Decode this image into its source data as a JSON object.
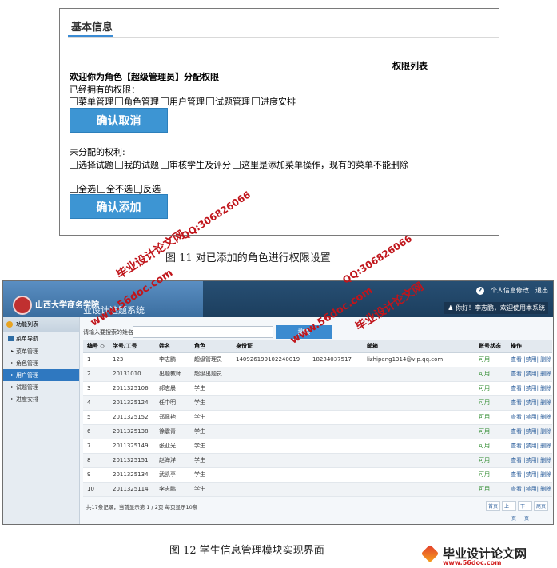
{
  "fig11": {
    "panel_title": "基本信息",
    "list_title": "权限列表",
    "welcome": "欢迎你为角色【超级管理员】分配权限",
    "owned_label": "已经拥有的权限：",
    "owned": [
      "菜单管理",
      "角色管理",
      "用户管理",
      "试题管理",
      "进度安排"
    ],
    "confirm_cancel": "确认取消",
    "unassigned_label": "未分配的权利:",
    "unassigned": [
      "选择试题",
      "我的试题",
      "审核学生及评分",
      "这里是添加菜单操作，现有的菜单不能删除"
    ],
    "selectors": [
      "全选",
      "全不选",
      "反选"
    ],
    "confirm_add": "确认添加",
    "caption": "图 11   对已添加的角色进行权限设置"
  },
  "fig12": {
    "school": "山西大学商务学院",
    "system_title": "业设计选题系统",
    "top_links": [
      "个人信息修改",
      "退出"
    ],
    "greeting": "你好！李志鹏，欢迎使用本系统",
    "sidebar": {
      "head": "功能列表",
      "nav": "菜单导航",
      "items": [
        "菜单管理",
        "角色管理",
        "用户管理",
        "试题管理",
        "进度安排"
      ],
      "active_index": 2
    },
    "search_label": "请输入要搜索的姓名：",
    "search_button": "搜索",
    "table": {
      "headers": [
        "编号 ◇",
        "学号/工号",
        "姓名",
        "角色",
        "身份证",
        "",
        "邮箱",
        "账号状态",
        "操作"
      ],
      "rows": [
        [
          "1",
          "123",
          "李志鹏",
          "超级管理员",
          "140926199102240019",
          "18234037517",
          "lizhipeng1314@vip.qq.com",
          "可用",
          "查看 |禁用| 删除"
        ],
        [
          "2",
          "20131010",
          "出题教师",
          "超级出题员",
          "",
          "",
          "",
          "可用",
          "查看 |禁用| 删除"
        ],
        [
          "3",
          "2011325106",
          "郝志晨",
          "学生",
          "",
          "",
          "",
          "可用",
          "查看 |禁用| 删除"
        ],
        [
          "4",
          "2011325124",
          "任中明",
          "学生",
          "",
          "",
          "",
          "可用",
          "查看 |禁用| 删除"
        ],
        [
          "5",
          "2011325152",
          "郑佩艳",
          "学生",
          "",
          "",
          "",
          "可用",
          "查看 |禁用| 删除"
        ],
        [
          "6",
          "2011325138",
          "徐震青",
          "学生",
          "",
          "",
          "",
          "可用",
          "查看 |禁用| 删除"
        ],
        [
          "7",
          "2011325149",
          "张亚光",
          "学生",
          "",
          "",
          "",
          "可用",
          "查看 |禁用| 删除"
        ],
        [
          "8",
          "2011325151",
          "赵海洋",
          "学生",
          "",
          "",
          "",
          "可用",
          "查看 |禁用| 删除"
        ],
        [
          "9",
          "2011325134",
          "武凯亭",
          "学生",
          "",
          "",
          "",
          "可用",
          "查看 |禁用| 删除"
        ],
        [
          "10",
          "2011325114",
          "李志鹏",
          "学生",
          "",
          "",
          "",
          "可用",
          "查看 |禁用| 删除"
        ]
      ]
    },
    "footer_info": "共17条记录，当前显示第 1 / 2页 每页显示10条",
    "pager": [
      "首页",
      "上一",
      "下一",
      "尾页"
    ],
    "pager2": [
      "页",
      "页"
    ],
    "caption": "图 12   学生信息管理模块实现界面"
  },
  "watermarks": {
    "site": "www.56doc.com",
    "qq": "QQ:306826066",
    "brand": "毕业设计论文网"
  },
  "brand_footer": {
    "name": "毕业设计论文网",
    "url": "www.56doc.com"
  }
}
